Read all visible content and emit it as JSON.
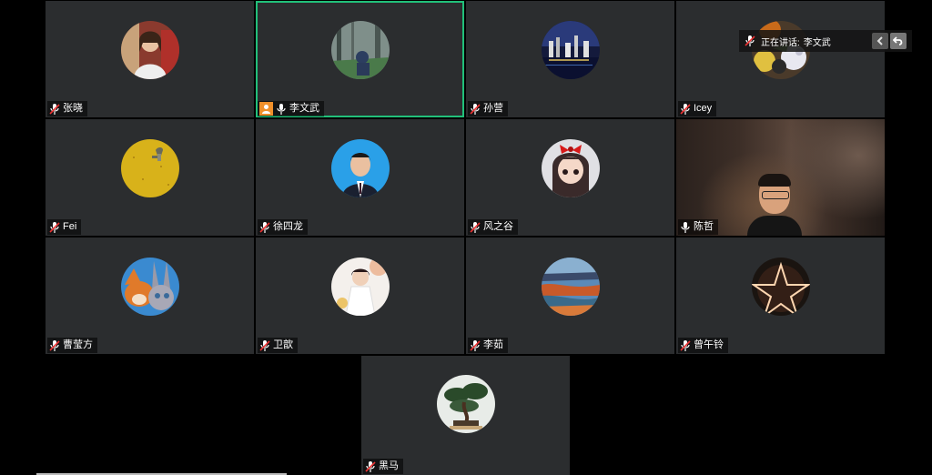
{
  "speaker_bar": {
    "label": "正在讲话:",
    "name": "李文武"
  },
  "participants": [
    {
      "id": "zhangxiao",
      "name": "张晓",
      "mic": "muted",
      "av": "av-portrait-red"
    },
    {
      "id": "liwenwu",
      "name": "李文武",
      "mic": "on",
      "active": true,
      "host": true,
      "av": "av-forest"
    },
    {
      "id": "sunying",
      "name": "孙营",
      "mic": "muted",
      "av": "av-night-city"
    },
    {
      "id": "icey",
      "name": "Icey",
      "mic": "muted",
      "av": "av-flowers"
    },
    {
      "id": "fei",
      "name": "Fei",
      "mic": "muted",
      "av": "av-yellow-field"
    },
    {
      "id": "xusilong",
      "name": "徐四龙",
      "mic": "muted",
      "av": "av-suit"
    },
    {
      "id": "fengzhigu",
      "name": "风之谷",
      "mic": "muted",
      "av": "av-anime"
    },
    {
      "id": "chenzhe",
      "name": "陈哲",
      "mic": "on",
      "video": true
    },
    {
      "id": "caoyingfang",
      "name": "曹莹方",
      "mic": "muted",
      "av": "av-cartoon"
    },
    {
      "id": "weixin",
      "name": "卫歆",
      "mic": "muted",
      "av": "av-girl-white"
    },
    {
      "id": "liru",
      "name": "李茹",
      "mic": "muted",
      "av": "av-lake"
    },
    {
      "id": "zengwuling",
      "name": "曾午铃",
      "mic": "muted",
      "av": "av-star"
    },
    {
      "id": "heima",
      "name": "黑马",
      "mic": "muted",
      "av": "av-bonsai"
    }
  ]
}
